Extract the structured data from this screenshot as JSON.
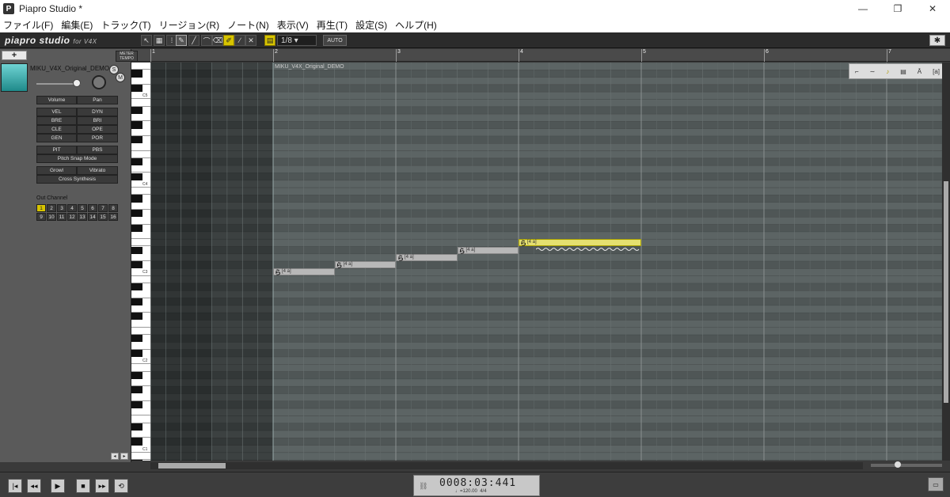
{
  "window": {
    "title": "Piapro Studio *",
    "icon": "piapro-app-icon"
  },
  "menu": [
    "ファイル(F)",
    "編集(E)",
    "トラック(T)",
    "リージョン(R)",
    "ノート(N)",
    "表示(V)",
    "再生(T)",
    "設定(S)",
    "ヘルプ(H)"
  ],
  "toolbar": {
    "logo": "piapro studio",
    "logo_suffix": "for V4X",
    "quantize": "1/8",
    "auto_label": "AUTO"
  },
  "track": {
    "name": "MIKU_V4X_Original_DEMO",
    "solo": "S",
    "mute": "M",
    "meter_label": "METER TEMPO",
    "params": [
      [
        "Volume",
        "Pan"
      ],
      [
        "VEL",
        "DYN"
      ],
      [
        "BRE",
        "BRI"
      ],
      [
        "CLE",
        "OPE"
      ],
      [
        "GEN",
        "POR"
      ],
      [
        "PIT",
        "PBS"
      ],
      [
        "Pitch Snap Mode"
      ],
      [
        "Growl",
        "Vibrato"
      ],
      [
        "Cross Synthesis"
      ]
    ],
    "out_channel_label": "Out Channel",
    "channels": [
      "1",
      "2",
      "3",
      "4",
      "5",
      "6",
      "7",
      "8",
      "9",
      "10",
      "11",
      "12",
      "13",
      "14",
      "15",
      "16"
    ],
    "active_channel": "1"
  },
  "ruler": {
    "bars": [
      "1",
      "2",
      "3",
      "4",
      "5",
      "6",
      "7"
    ]
  },
  "keyboard": {
    "labels": [
      "C5",
      "C4",
      "C3",
      "C2",
      "C1"
    ]
  },
  "region": {
    "name": "MIKU_V4X_Original_DEMO"
  },
  "notes": [
    {
      "lyric": "ら",
      "phoneme": "[4 a]",
      "bar_start": 2.0,
      "bar_len": 0.5,
      "pitch": 48,
      "selected": false
    },
    {
      "lyric": "ら",
      "phoneme": "[4 a]",
      "bar_start": 2.5,
      "bar_len": 0.5,
      "pitch": 49,
      "selected": false
    },
    {
      "lyric": "ら",
      "phoneme": "[4 a]",
      "bar_start": 3.0,
      "bar_len": 0.5,
      "pitch": 50,
      "selected": false
    },
    {
      "lyric": "ら",
      "phoneme": "[4 a]",
      "bar_start": 3.5,
      "bar_len": 0.5,
      "pitch": 51,
      "selected": false
    },
    {
      "lyric": "ら",
      "phoneme": "[4 a]",
      "bar_start": 4.0,
      "bar_len": 1.0,
      "pitch": 52,
      "selected": true
    }
  ],
  "transport": {
    "time": "0008:03:441",
    "tempo": "♩=120.00",
    "signature": "4/4"
  },
  "colors": {
    "selected_note": "#e5e070",
    "note": "#b8b8b8",
    "accent": "#d7c400"
  }
}
